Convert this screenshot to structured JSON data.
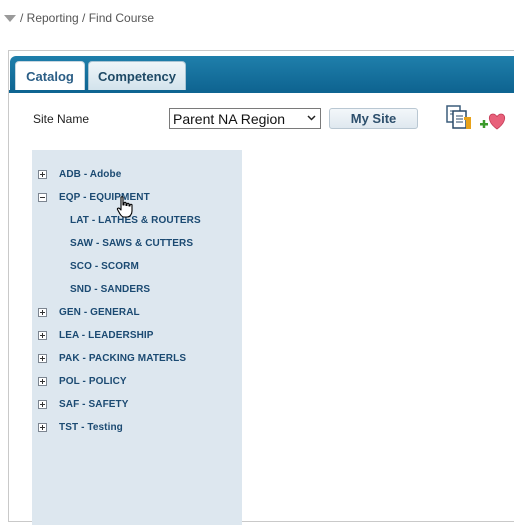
{
  "breadcrumb": {
    "text": "/ Reporting / Find Course"
  },
  "tabs": [
    {
      "label": "Catalog",
      "active": true
    },
    {
      "label": "Competency",
      "active": false
    }
  ],
  "filters": {
    "site_label": "Site Name",
    "site_value": "Parent NA Region",
    "my_site_label": "My Site"
  },
  "icons": {
    "copy": "copy-icon",
    "favorite": "add-favorite-icon",
    "expand": "plus-box-icon",
    "collapse": "minus-box-icon"
  },
  "tree": {
    "nodes": [
      {
        "label": "ADB - Adobe",
        "state": "collapsed"
      },
      {
        "label": "EQP - EQUIPMENT",
        "state": "expanded",
        "children": [
          "LAT - LATHES & ROUTERS",
          "SAW - SAWS & CUTTERS",
          "SCO - SCORM",
          "SND - SANDERS"
        ]
      },
      {
        "label": "GEN - GENERAL",
        "state": "collapsed"
      },
      {
        "label": "LEA - LEADERSHIP",
        "state": "collapsed"
      },
      {
        "label": "PAK - PACKING MATERLS",
        "state": "collapsed"
      },
      {
        "label": "POL - POLICY",
        "state": "collapsed"
      },
      {
        "label": "SAF - SAFETY",
        "state": "collapsed"
      },
      {
        "label": "TST - Testing",
        "state": "collapsed"
      }
    ]
  },
  "colors": {
    "tab_bar": "#1f7fab",
    "tree_bg": "#dde7ef",
    "tree_text": "#1b4a72"
  }
}
